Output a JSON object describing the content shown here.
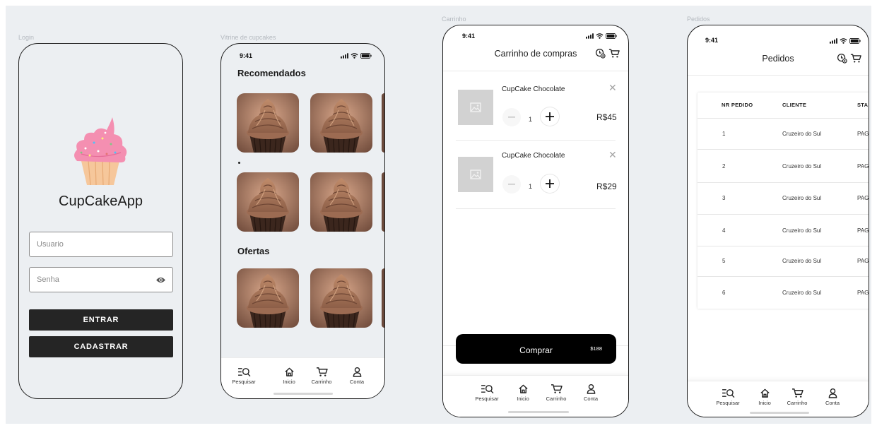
{
  "frames": {
    "login": "Login",
    "showcase": "Vitrine de cupcakes",
    "cart": "Carrinho",
    "orders": "Pedidos"
  },
  "status": {
    "time": "9:41"
  },
  "login": {
    "app_title": "CupCakeApp",
    "username_placeholder": "Usuario",
    "password_placeholder": "Senha",
    "enter_label": "ENTRAR",
    "register_label": "CADASTRAR"
  },
  "showcase": {
    "recommended_title": "Recomendados",
    "offers_title": "Ofertas"
  },
  "nav": {
    "search": "Pesquisar",
    "home": "Inicio",
    "cart": "Carrinho",
    "account": "Conta"
  },
  "cart": {
    "title": "Carrinho de compras",
    "items": [
      {
        "name": "CupCake Chocolate",
        "qty": "1",
        "price": "R$45"
      },
      {
        "name": "CupCake Chocolate",
        "qty": "1",
        "price": "R$29"
      }
    ],
    "buy_label": "Comprar",
    "total": "$188"
  },
  "orders": {
    "title": "Pedidos",
    "headers": [
      "NR PEDIDO",
      "CLIENTE",
      "STA"
    ],
    "rows": [
      [
        "1",
        "Cruzeiro do Sul",
        "PAG"
      ],
      [
        "2",
        "Cruzeiro do Sul",
        "PAG"
      ],
      [
        "3",
        "Cruzeiro do Sul",
        "PAG"
      ],
      [
        "4",
        "Cruzeiro do Sul",
        "PAG"
      ],
      [
        "5",
        "Cruzeiro do Sul",
        "PAG"
      ],
      [
        "6",
        "Cruzeiro do Sul",
        "PAG"
      ]
    ]
  },
  "colors": {
    "canvas": "#eceff2",
    "button_dark": "#252525",
    "buy_button": "#000000",
    "frosting_pink": "#f48fb1",
    "cake_base": "#f6c79b",
    "chocolate": "#7a5140"
  },
  "icons": [
    "cellular-icon",
    "wifi-icon",
    "battery-icon",
    "eye-icon",
    "search-icon",
    "home-icon",
    "cart-icon",
    "user-icon",
    "image-icon",
    "close-icon",
    "minus-icon",
    "plus-icon",
    "history-icon"
  ]
}
